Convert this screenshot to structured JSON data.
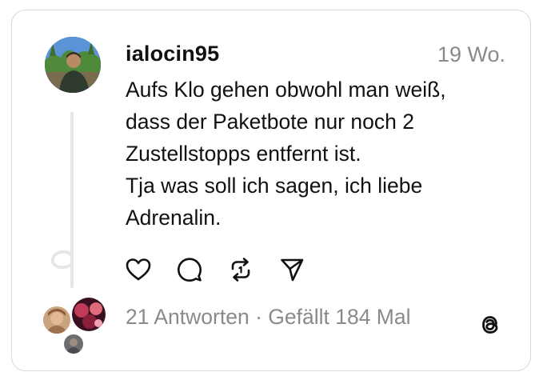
{
  "post": {
    "username": "ialocin95",
    "timestamp": "19 Wo.",
    "lines": [
      "Aufs Klo gehen obwohl man weiß,",
      "dass der Paketbote nur noch 2",
      "Zustellstopps entfernt ist.",
      "Tja was soll ich sagen, ich liebe",
      "Adrenalin."
    ]
  },
  "stats": {
    "replies": "21 Antworten",
    "separator": " · ",
    "likes": "Gefällt 184 Mal"
  },
  "icons": {
    "like": "heart-icon",
    "reply": "comment-icon",
    "repost": "repost-icon",
    "share": "send-icon",
    "brand": "threads-logo-icon"
  },
  "colors": {
    "text": "#111111",
    "muted": "#8a8a8a",
    "border": "#d9d9d9"
  }
}
